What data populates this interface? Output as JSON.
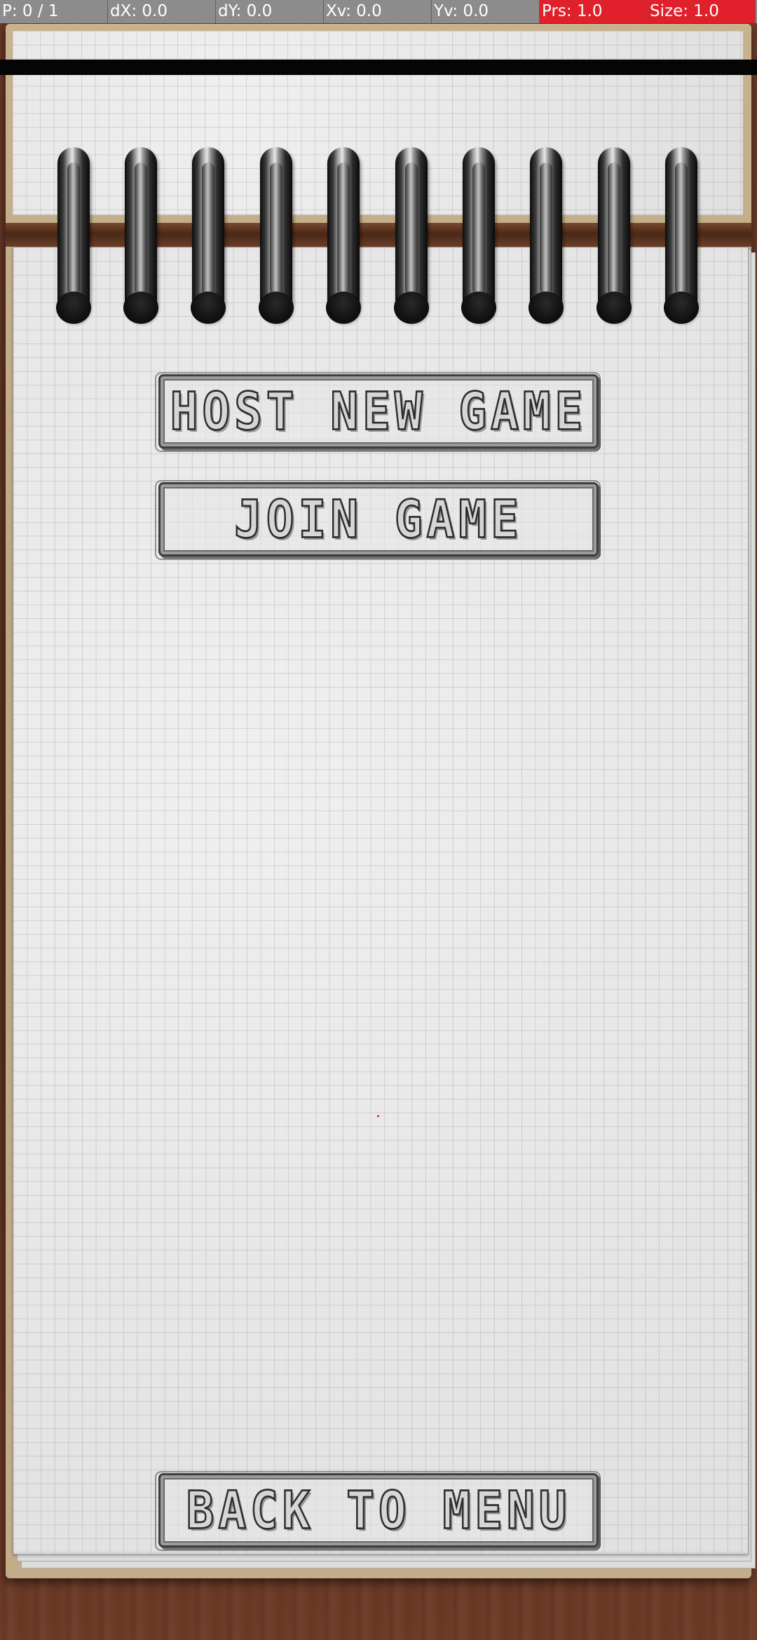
{
  "debug": {
    "pointer": "P: 0 / 1",
    "dx": "dX: 0.0",
    "dy": "dY: 0.0",
    "xv": "Xv: 0.0",
    "yv": "Yv: 0.0",
    "pressure": "Prs: 1.0",
    "size": "Size: 1.0"
  },
  "menu": {
    "host_label": "HOST NEW GAME",
    "join_label": "JOIN GAME",
    "back_label": "BACK TO MENU"
  },
  "colors": {
    "debug_bar": "#8c8c8c",
    "debug_alert": "#e0202a",
    "paper": "#e7e7e7",
    "wood": "#5c301f",
    "pencil": "#3d3d3d"
  }
}
